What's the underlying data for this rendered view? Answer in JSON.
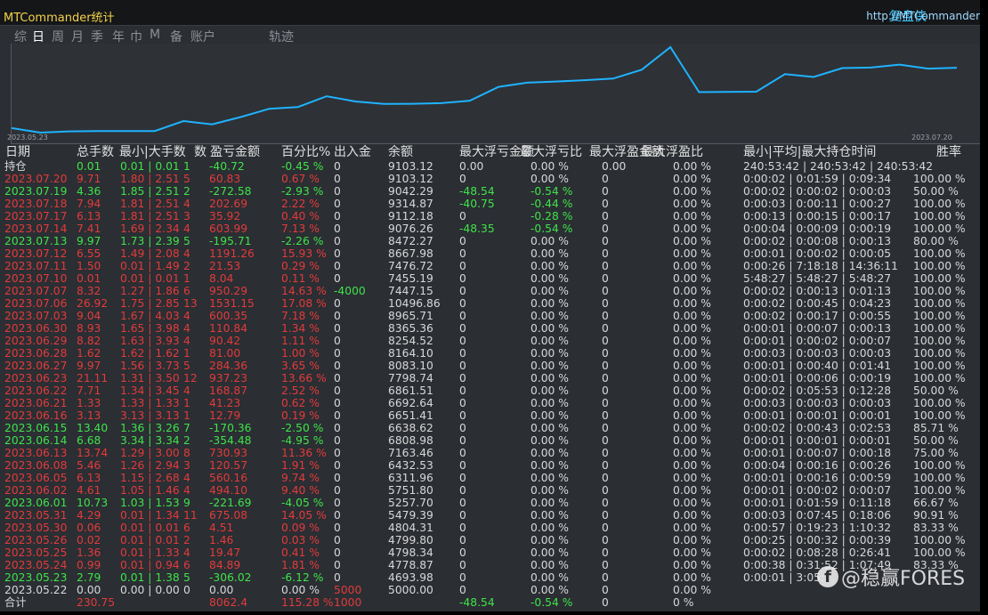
{
  "window": {
    "title": "MTCommander统计",
    "brand": "复盘侠",
    "website": "http://MTCommander"
  },
  "tabs": [
    "综",
    "日",
    "周",
    "月",
    "季",
    "年",
    "巾",
    "M",
    "备",
    "账户",
    "轨迹"
  ],
  "active_tab": 1,
  "colors": {
    "accent": "#1fb3ff",
    "loss": "#e23b3b",
    "profit": "#3fe34a",
    "title": "#f3d34a"
  },
  "chart_data": {
    "type": "line",
    "x_start_label": "2023.05.23",
    "x_end_label": "2023.07.20",
    "x": [
      "2023.05.22",
      "2023.05.23",
      "2023.05.24",
      "2023.05.25",
      "2023.05.26",
      "2023.05.30",
      "2023.05.31",
      "2023.06.01",
      "2023.06.02",
      "2023.06.05",
      "2023.06.08",
      "2023.06.13",
      "2023.06.14",
      "2023.06.15",
      "2023.06.16",
      "2023.06.21",
      "2023.06.22",
      "2023.06.23",
      "2023.06.27",
      "2023.06.28",
      "2023.06.29",
      "2023.06.30",
      "2023.07.03",
      "2023.07.06",
      "2023.07.07",
      "2023.07.10",
      "2023.07.11",
      "2023.07.12",
      "2023.07.13",
      "2023.07.14",
      "2023.07.17",
      "2023.07.18",
      "2023.07.19",
      "2023.07.20"
    ],
    "values": [
      5000.0,
      4693.98,
      4778.87,
      4798.34,
      4799.8,
      4804.31,
      5479.39,
      5257.7,
      5751.8,
      6311.96,
      6432.53,
      7163.46,
      6808.98,
      6638.62,
      6651.41,
      6692.64,
      6861.51,
      7798.74,
      8083.1,
      8164.1,
      8254.52,
      8365.36,
      8965.71,
      10496.86,
      7447.15,
      7455.19,
      7476.72,
      8667.98,
      8472.27,
      9076.26,
      9112.18,
      9314.87,
      9042.29,
      9103.12
    ],
    "grid": false
  },
  "table": {
    "headers": [
      "日期",
      "总手数",
      "最小|大手数",
      "数",
      "盈亏金额",
      "百分比%",
      "出入金",
      "余额",
      "最大浮亏金额",
      "最大浮亏比",
      "最大浮盈金额",
      "最大浮盈比",
      "最小|平均|最大持仓时间",
      "胜率"
    ],
    "rows": [
      {
        "date": "持仓",
        "lots": "0.01",
        "minmax": "0.01 | 0.01",
        "cnt": "1",
        "pnl": "-40.72",
        "pct": "-0.45 %",
        "dep": "0",
        "bal": "9103.12",
        "mfl": "0.00",
        "mflp": "0.00 %",
        "mfp": "0.00",
        "mfpp": "0.00 %",
        "hold": "240:53:42 | 240:53:42 | 240:53:42",
        "win": "",
        "c": "g",
        "dc": "w"
      },
      {
        "date": "2023.07.20",
        "lots": "9.71",
        "minmax": "1.80 | 2.51",
        "cnt": "5",
        "pnl": "60.83",
        "pct": "0.67 %",
        "dep": "0",
        "bal": "9103.12",
        "mfl": "0",
        "mflp": "0.00 %",
        "mfp": "0",
        "mfpp": "0.00 %",
        "hold": "0:00:02 | 0:01:59 | 0:09:34",
        "win": "100.00 %",
        "c": "r"
      },
      {
        "date": "2023.07.19",
        "lots": "4.36",
        "minmax": "1.85 | 2.51",
        "cnt": "2",
        "pnl": "-272.58",
        "pct": "-2.93 %",
        "dep": "0",
        "bal": "9042.29",
        "mfl": "-48.54",
        "mflp": "-0.54 %",
        "mfp": "0",
        "mfpp": "0.00 %",
        "hold": "0:00:02 | 0:00:02 | 0:00:03",
        "win": "50.00 %",
        "c": "g"
      },
      {
        "date": "2023.07.18",
        "lots": "7.94",
        "minmax": "1.81 | 2.51",
        "cnt": "4",
        "pnl": "202.69",
        "pct": "2.22 %",
        "dep": "0",
        "bal": "9314.87",
        "mfl": "-40.75",
        "mflp": "-0.44 %",
        "mfp": "0",
        "mfpp": "0.00 %",
        "hold": "0:00:03 | 0:00:11 | 0:00:27",
        "win": "100.00 %",
        "c": "r"
      },
      {
        "date": "2023.07.17",
        "lots": "6.13",
        "minmax": "1.81 | 2.51",
        "cnt": "3",
        "pnl": "35.92",
        "pct": "0.40 %",
        "dep": "0",
        "bal": "9112.18",
        "mfl": "0",
        "mflp": "-0.28 %",
        "mfp": "0",
        "mfpp": "0.00 %",
        "hold": "0:00:13 | 0:00:15 | 0:00:17",
        "win": "100.00 %",
        "c": "r"
      },
      {
        "date": "2023.07.14",
        "lots": "7.41",
        "minmax": "1.69 | 2.34",
        "cnt": "4",
        "pnl": "603.99",
        "pct": "7.13 %",
        "dep": "0",
        "bal": "9076.26",
        "mfl": "-48.35",
        "mflp": "-0.54 %",
        "mfp": "0",
        "mfpp": "0.00 %",
        "hold": "0:00:04 | 0:00:09 | 0:00:19",
        "win": "100.00 %",
        "c": "r"
      },
      {
        "date": "2023.07.13",
        "lots": "9.97",
        "minmax": "1.73 | 2.39",
        "cnt": "5",
        "pnl": "-195.71",
        "pct": "-2.26 %",
        "dep": "0",
        "bal": "8472.27",
        "mfl": "0",
        "mflp": "0.00 %",
        "mfp": "0",
        "mfpp": "0.00 %",
        "hold": "0:00:02 | 0:00:08 | 0:00:13",
        "win": "80.00 %",
        "c": "g"
      },
      {
        "date": "2023.07.12",
        "lots": "6.55",
        "minmax": "1.49 | 2.08",
        "cnt": "4",
        "pnl": "1191.26",
        "pct": "15.93 %",
        "dep": "0",
        "bal": "8667.98",
        "mfl": "0",
        "mflp": "0.00 %",
        "mfp": "0",
        "mfpp": "0.00 %",
        "hold": "0:00:01 | 0:00:02 | 0:00:05",
        "win": "100.00 %",
        "c": "r"
      },
      {
        "date": "2023.07.11",
        "lots": "1.50",
        "minmax": "0.01 | 1.49",
        "cnt": "2",
        "pnl": "21.53",
        "pct": "0.29 %",
        "dep": "0",
        "bal": "7476.72",
        "mfl": "0",
        "mflp": "0.00 %",
        "mfp": "0",
        "mfpp": "0.00 %",
        "hold": "0:00:26 | 7:18:18 | 14:36:11",
        "win": "100.00 %",
        "c": "r"
      },
      {
        "date": "2023.07.10",
        "lots": "0.01",
        "minmax": "0.01 | 0.01",
        "cnt": "1",
        "pnl": "8.04",
        "pct": "0.11 %",
        "dep": "0",
        "bal": "7455.19",
        "mfl": "0",
        "mflp": "0.00 %",
        "mfp": "0",
        "mfpp": "0.00 %",
        "hold": "5:48:27 | 5:48:27 | 5:48:27",
        "win": "100.00 %",
        "c": "r"
      },
      {
        "date": "2023.07.07",
        "lots": "8.32",
        "minmax": "1.27 | 1.86",
        "cnt": "6",
        "pnl": "950.29",
        "pct": "14.63 %",
        "dep": "-4000",
        "bal": "7447.15",
        "mfl": "0",
        "mflp": "0.00 %",
        "mfp": "0",
        "mfpp": "0.00 %",
        "hold": "0:00:02 | 0:00:13 | 0:01:13",
        "win": "100.00 %",
        "c": "r",
        "depc": "g"
      },
      {
        "date": "2023.07.06",
        "lots": "26.92",
        "minmax": "1.75 | 2.85",
        "cnt": "13",
        "pnl": "1531.15",
        "pct": "17.08 %",
        "dep": "0",
        "bal": "10496.86",
        "mfl": "0",
        "mflp": "0.00 %",
        "mfp": "0",
        "mfpp": "0.00 %",
        "hold": "0:00:02 | 0:00:45 | 0:04:23",
        "win": "100.00 %",
        "c": "r"
      },
      {
        "date": "2023.07.03",
        "lots": "9.04",
        "minmax": "1.67 | 4.03",
        "cnt": "4",
        "pnl": "600.35",
        "pct": "7.18 %",
        "dep": "0",
        "bal": "8965.71",
        "mfl": "0",
        "mflp": "0.00 %",
        "mfp": "0",
        "mfpp": "0.00 %",
        "hold": "0:00:02 | 0:00:17 | 0:00:55",
        "win": "100.00 %",
        "c": "r"
      },
      {
        "date": "2023.06.30",
        "lots": "8.93",
        "minmax": "1.65 | 3.98",
        "cnt": "4",
        "pnl": "110.84",
        "pct": "1.34 %",
        "dep": "0",
        "bal": "8365.36",
        "mfl": "0",
        "mflp": "0.00 %",
        "mfp": "0",
        "mfpp": "0.00 %",
        "hold": "0:00:01 | 0:00:07 | 0:00:13",
        "win": "100.00 %",
        "c": "r"
      },
      {
        "date": "2023.06.29",
        "lots": "8.82",
        "minmax": "1.63 | 3.93",
        "cnt": "4",
        "pnl": "90.42",
        "pct": "1.11 %",
        "dep": "0",
        "bal": "8254.52",
        "mfl": "0",
        "mflp": "0.00 %",
        "mfp": "0",
        "mfpp": "0.00 %",
        "hold": "0:00:01 | 0:00:02 | 0:00:07",
        "win": "100.00 %",
        "c": "r"
      },
      {
        "date": "2023.06.28",
        "lots": "1.62",
        "minmax": "1.62 | 1.62",
        "cnt": "1",
        "pnl": "81.00",
        "pct": "1.00 %",
        "dep": "0",
        "bal": "8164.10",
        "mfl": "0",
        "mflp": "0.00 %",
        "mfp": "0",
        "mfpp": "0.00 %",
        "hold": "0:00:03 | 0:00:03 | 0:00:03",
        "win": "100.00 %",
        "c": "r"
      },
      {
        "date": "2023.06.27",
        "lots": "9.97",
        "minmax": "1.56 | 3.73",
        "cnt": "5",
        "pnl": "284.36",
        "pct": "3.65 %",
        "dep": "0",
        "bal": "8083.10",
        "mfl": "0",
        "mflp": "0.00 %",
        "mfp": "0",
        "mfpp": "0.00 %",
        "hold": "0:00:01 | 0:00:40 | 0:01:41",
        "win": "100.00 %",
        "c": "r"
      },
      {
        "date": "2023.06.23",
        "lots": "21.11",
        "minmax": "1.31 | 3.50",
        "cnt": "12",
        "pnl": "937.23",
        "pct": "13.66 %",
        "dep": "0",
        "bal": "7798.74",
        "mfl": "0",
        "mflp": "0.00 %",
        "mfp": "0",
        "mfpp": "0.00 %",
        "hold": "0:00:01 | 0:00:06 | 0:00:19",
        "win": "100.00 %",
        "c": "r"
      },
      {
        "date": "2023.06.22",
        "lots": "7.71",
        "minmax": "1.34 | 3.45",
        "cnt": "4",
        "pnl": "168.87",
        "pct": "2.52 %",
        "dep": "0",
        "bal": "6861.51",
        "mfl": "0",
        "mflp": "0.00 %",
        "mfp": "0",
        "mfpp": "0.00 %",
        "hold": "0:00:02 | 0:05:53 | 0:12:28",
        "win": "50.00 %",
        "c": "r"
      },
      {
        "date": "2023.06.21",
        "lots": "1.33",
        "minmax": "1.33 | 1.33",
        "cnt": "1",
        "pnl": "41.23",
        "pct": "0.62 %",
        "dep": "0",
        "bal": "6692.64",
        "mfl": "0",
        "mflp": "0.00 %",
        "mfp": "0",
        "mfpp": "0.00 %",
        "hold": "0:00:03 | 0:00:03 | 0:00:03",
        "win": "100.00 %",
        "c": "r"
      },
      {
        "date": "2023.06.16",
        "lots": "3.13",
        "minmax": "3.13 | 3.13",
        "cnt": "1",
        "pnl": "12.79",
        "pct": "0.19 %",
        "dep": "0",
        "bal": "6651.41",
        "mfl": "0",
        "mflp": "0.00 %",
        "mfp": "0",
        "mfpp": "0.00 %",
        "hold": "0:00:01 | 0:00:01 | 0:00:01",
        "win": "100.00 %",
        "c": "r"
      },
      {
        "date": "2023.06.15",
        "lots": "13.40",
        "minmax": "1.36 | 3.26",
        "cnt": "7",
        "pnl": "-170.36",
        "pct": "-2.50 %",
        "dep": "0",
        "bal": "6638.62",
        "mfl": "0",
        "mflp": "0.00 %",
        "mfp": "0",
        "mfpp": "0.00 %",
        "hold": "0:00:02 | 0:00:43 | 0:02:53",
        "win": "85.71 %",
        "c": "g"
      },
      {
        "date": "2023.06.14",
        "lots": "6.68",
        "minmax": "3.34 | 3.34",
        "cnt": "2",
        "pnl": "-354.48",
        "pct": "-4.95 %",
        "dep": "0",
        "bal": "6808.98",
        "mfl": "0",
        "mflp": "0.00 %",
        "mfp": "0",
        "mfpp": "0.00 %",
        "hold": "0:00:01 | 0:00:01 | 0:00:01",
        "win": "50.00 %",
        "c": "g"
      },
      {
        "date": "2023.06.13",
        "lots": "13.74",
        "minmax": "1.29 | 3.00",
        "cnt": "8",
        "pnl": "730.93",
        "pct": "11.36 %",
        "dep": "0",
        "bal": "7163.46",
        "mfl": "0",
        "mflp": "0.00 %",
        "mfp": "0",
        "mfpp": "0.00 %",
        "hold": "0:00:01 | 0:00:07 | 0:00:18",
        "win": "75.00 %",
        "c": "r"
      },
      {
        "date": "2023.06.08",
        "lots": "5.46",
        "minmax": "1.26 | 2.94",
        "cnt": "3",
        "pnl": "120.57",
        "pct": "1.91 %",
        "dep": "0",
        "bal": "6432.53",
        "mfl": "0",
        "mflp": "0.00 %",
        "mfp": "0",
        "mfpp": "0.00 %",
        "hold": "0:00:04 | 0:00:16 | 0:00:26",
        "win": "100.00 %",
        "c": "r"
      },
      {
        "date": "2023.06.05",
        "lots": "6.13",
        "minmax": "1.15 | 2.68",
        "cnt": "4",
        "pnl": "560.16",
        "pct": "9.74 %",
        "dep": "0",
        "bal": "6311.96",
        "mfl": "0",
        "mflp": "0.00 %",
        "mfp": "0",
        "mfpp": "0.00 %",
        "hold": "0:00:01 | 0:00:16 | 0:00:59",
        "win": "100.00 %",
        "c": "r"
      },
      {
        "date": "2023.06.02",
        "lots": "4.61",
        "minmax": "1.05 | 1.46",
        "cnt": "4",
        "pnl": "494.10",
        "pct": "9.40 %",
        "dep": "0",
        "bal": "5751.80",
        "mfl": "0",
        "mflp": "0.00 %",
        "mfp": "0",
        "mfpp": "0.00 %",
        "hold": "0:00:01 | 0:00:02 | 0:00:07",
        "win": "100.00 %",
        "c": "r"
      },
      {
        "date": "2023.06.01",
        "lots": "10.73",
        "minmax": "1.03 | 1.53",
        "cnt": "9",
        "pnl": "-221.69",
        "pct": "-4.05 %",
        "dep": "0",
        "bal": "5257.70",
        "mfl": "0",
        "mflp": "0.00 %",
        "mfp": "0",
        "mfpp": "0.00 %",
        "hold": "0:00:01 | 0:01:59 | 0:11:18",
        "win": "66.67 %",
        "c": "g"
      },
      {
        "date": "2023.05.31",
        "lots": "4.29",
        "minmax": "0.01 | 1.34",
        "cnt": "11",
        "pnl": "675.08",
        "pct": "14.05 %",
        "dep": "0",
        "bal": "5479.39",
        "mfl": "0",
        "mflp": "0.00 %",
        "mfp": "0",
        "mfpp": "0.00 %",
        "hold": "0:00:03 | 0:07:45 | 0:18:06",
        "win": "90.91 %",
        "c": "r"
      },
      {
        "date": "2023.05.30",
        "lots": "0.06",
        "minmax": "0.01 | 0.01",
        "cnt": "6",
        "pnl": "4.51",
        "pct": "0.09 %",
        "dep": "0",
        "bal": "4804.31",
        "mfl": "0",
        "mflp": "0.00 %",
        "mfp": "0",
        "mfpp": "0.00 %",
        "hold": "0:00:57 | 0:19:23 | 1:10:32",
        "win": "83.33 %",
        "c": "r"
      },
      {
        "date": "2023.05.26",
        "lots": "0.02",
        "minmax": "0.01 | 0.01",
        "cnt": "2",
        "pnl": "1.46",
        "pct": "0.03 %",
        "dep": "0",
        "bal": "4799.80",
        "mfl": "0",
        "mflp": "0.00 %",
        "mfp": "0",
        "mfpp": "0.00 %",
        "hold": "0:00:25 | 0:00:32 | 0:00:39",
        "win": "100.00 %",
        "c": "r"
      },
      {
        "date": "2023.05.25",
        "lots": "1.36",
        "minmax": "0.01 | 1.33",
        "cnt": "4",
        "pnl": "19.47",
        "pct": "0.41 %",
        "dep": "0",
        "bal": "4798.34",
        "mfl": "0",
        "mflp": "0.00 %",
        "mfp": "0",
        "mfpp": "0.00 %",
        "hold": "0:00:02 | 0:08:28 | 0:26:41",
        "win": "100.00 %",
        "c": "r"
      },
      {
        "date": "2023.05.24",
        "lots": "0.99",
        "minmax": "0.01 | 0.94",
        "cnt": "6",
        "pnl": "84.89",
        "pct": "1.81 %",
        "dep": "0",
        "bal": "4778.87",
        "mfl": "0",
        "mflp": "0.00 %",
        "mfp": "0",
        "mfpp": "0.00 %",
        "hold": "0:00:38 | 0:31:52 | 1:07:49",
        "win": "83.33 %",
        "c": "r"
      },
      {
        "date": "2023.05.23",
        "lots": "2.79",
        "minmax": "0.01 | 1.38",
        "cnt": "5",
        "pnl": "-306.02",
        "pct": "-6.12 %",
        "dep": "0",
        "bal": "4693.98",
        "mfl": "0",
        "mflp": "0.00 %",
        "mfp": "0",
        "mfpp": "0.00 %",
        "hold": "0:00:01 | 3:05:",
        "win": "",
        "c": "g"
      },
      {
        "date": "2023.05.22",
        "lots": "0.00",
        "minmax": "0.00 | 0.00",
        "cnt": "0",
        "pnl": "0.00",
        "pct": "0.00 %",
        "dep": "5000",
        "bal": "5000.00",
        "mfl": "0",
        "mflp": "0.00 %",
        "mfp": "0",
        "mfpp": "0.00 %",
        "hold": "",
        "win": "",
        "c": "w",
        "depc": "r"
      }
    ],
    "total": {
      "date": "合计",
      "lots": "230.75",
      "pnl": "8062.4",
      "pct": "115.28 %",
      "dep": "1000",
      "mfl": "-48.54",
      "mflp": "-0.54 %",
      "mfp": "0",
      "mfpp": "0 %"
    }
  },
  "watermark": {
    "icon_glyph": "f",
    "text": "@稳赢FORES"
  }
}
